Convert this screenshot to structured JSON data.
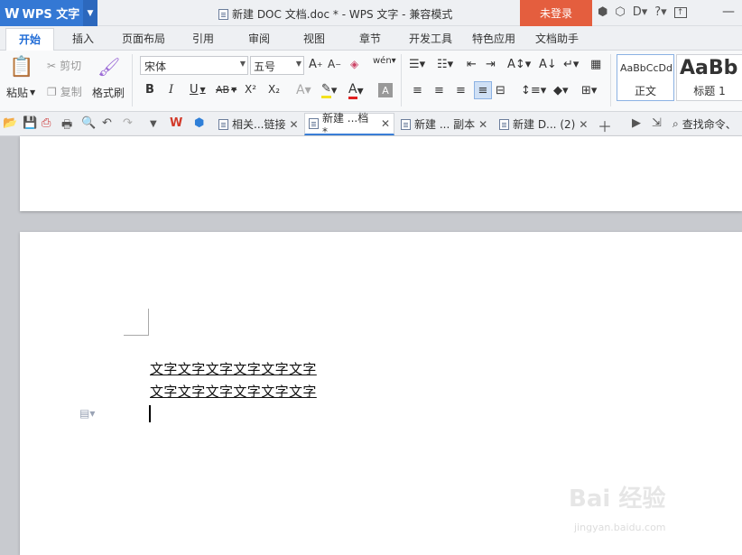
{
  "app": {
    "name": "WPS 文字",
    "logo_letter": "W",
    "window_title": "新建 DOC 文档.doc * - WPS 文字 - 兼容模式",
    "login_label": "未登录",
    "help_label": "?"
  },
  "menu": {
    "tabs": [
      "开始",
      "插入",
      "页面布局",
      "引用",
      "审阅",
      "视图",
      "章节",
      "开发工具",
      "特色应用",
      "文档助手"
    ],
    "active": "开始"
  },
  "ribbon": {
    "paste_label": "粘贴",
    "cut_label": "剪切",
    "copy_label": "复制",
    "format_painter_label": "格式刷",
    "font_name": "宋体",
    "font_size": "五号",
    "bold": "B",
    "italic": "I",
    "underline": "U",
    "strike": "AB",
    "superscript": "X²",
    "subscript": "X₂",
    "styles": [
      {
        "preview": "AaBbCcDd",
        "label": "正文"
      },
      {
        "preview": "AaBb",
        "label": "标题 1"
      }
    ]
  },
  "doc_tabs": [
    {
      "label": "相关...链接",
      "active": false
    },
    {
      "label": "新建 ...档 *",
      "active": true
    },
    {
      "label": "新建 ... 副本",
      "active": false
    },
    {
      "label": "新建 D... (2)",
      "active": false
    }
  ],
  "search": {
    "label": "查找命令、"
  },
  "document": {
    "lines": [
      "文字文字文字文字文字文字",
      "文字文字文字文字文字文字"
    ]
  },
  "watermark": {
    "text": "Bai 经验",
    "sub": "jingyan.baidu.com"
  },
  "colors": {
    "accent": "#3478d4",
    "login": "#e45e3e",
    "active_tab": "#1f6bd6"
  }
}
